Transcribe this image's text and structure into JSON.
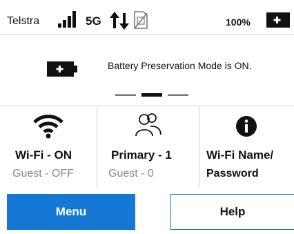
{
  "status_bar": {
    "carrier": "Telstra",
    "signal_bars": 4,
    "network_type": "5G",
    "data_activity_icon": "up-down-arrows-icon",
    "sim_icon": "sim-card-icon",
    "battery_percent": "100%",
    "battery_icon": "battery-full-icon"
  },
  "message": {
    "icon": "battery-icon",
    "text": "Battery Preservation Mode is ON.",
    "pages": 3,
    "active_page": 2
  },
  "tiles": [
    {
      "icon": "wifi-icon",
      "primary": "Wi-Fi - ON",
      "secondary": "Guest - OFF"
    },
    {
      "icon": "users-icon",
      "primary": "Primary - 1",
      "secondary": "Guest - 0"
    },
    {
      "icon": "info-icon",
      "primary": "Wi-Fi Name/",
      "secondary": "Password"
    }
  ],
  "buttons": {
    "menu_label": "Menu",
    "help_label": "Help"
  },
  "colors": {
    "accent": "#1478d4",
    "muted_text": "#8a8a8a",
    "divider": "#cfcfcf"
  }
}
